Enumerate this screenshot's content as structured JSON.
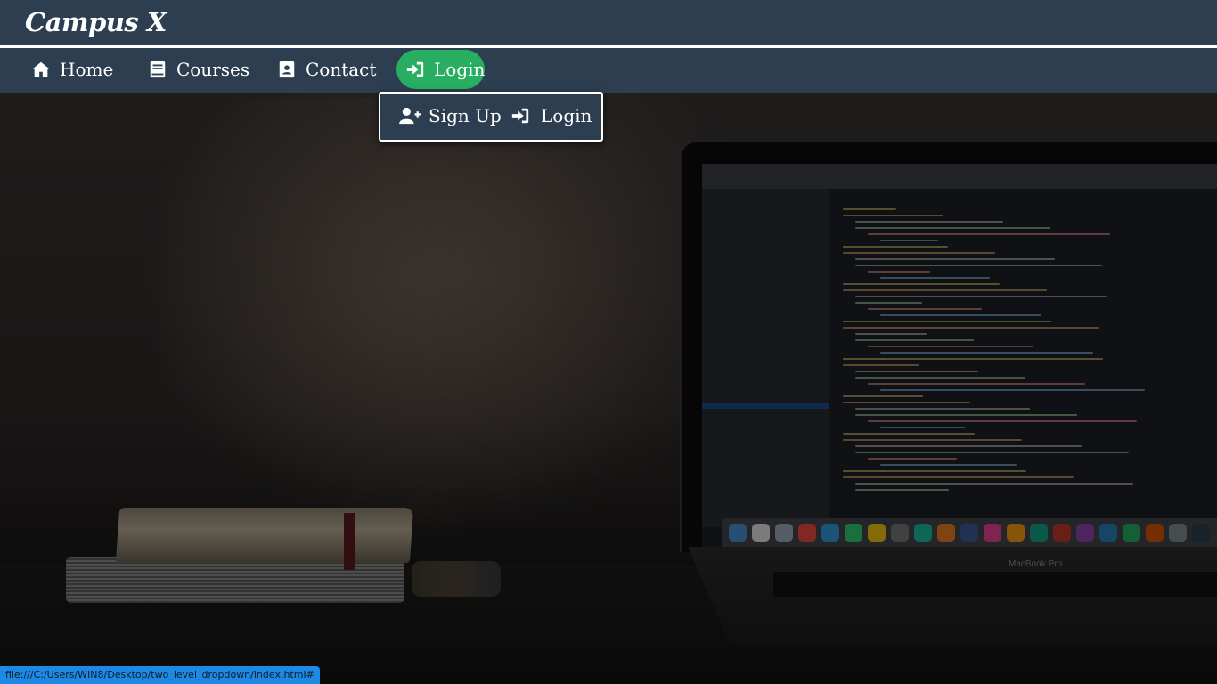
{
  "brand": {
    "logo_text": "Campus X"
  },
  "nav": {
    "items": [
      {
        "label": "Home",
        "icon": "home-icon"
      },
      {
        "label": "Courses",
        "icon": "book-icon"
      },
      {
        "label": "Contact",
        "icon": "contact-card-icon"
      },
      {
        "label": "Login",
        "icon": "sign-in-icon",
        "active": true
      }
    ],
    "active_color": "#27ae60"
  },
  "dropdown": {
    "items": [
      {
        "label": "Sign Up",
        "icon": "user-plus-icon"
      },
      {
        "label": "Login",
        "icon": "sign-in-icon"
      }
    ]
  },
  "laptop": {
    "brand_text": "MacBook Pro"
  },
  "status_bar": {
    "url": "file:///C:/Users/WIN8/Desktop/two_level_dropdown/index.html#"
  },
  "colors": {
    "header_bg": "#2c3e50",
    "status_bg": "#1e88e5"
  }
}
